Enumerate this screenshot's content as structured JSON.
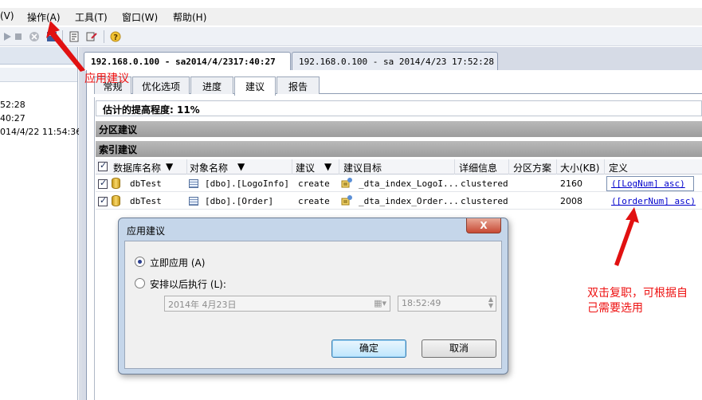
{
  "menu": {
    "items": [
      "(V)",
      "操作(A)",
      "工具(T)",
      "窗口(W)",
      "帮助(H)"
    ]
  },
  "left_panel": {
    "lines": [
      "52:28",
      "40:27",
      "014/4/22 11:54:36"
    ]
  },
  "doc_tabs": [
    "192.168.0.100 - sa2014/4/2317:40:27",
    "192.168.0.100 - sa 2014/4/23 17:52:28"
  ],
  "sub_tabs": [
    "常规",
    "优化选项",
    "进度",
    "建议",
    "报告"
  ],
  "estimate": "估计的提高程度: 11%",
  "sections": {
    "partition": "分区建议",
    "index": "索引建议"
  },
  "grid": {
    "headers": [
      "数据库名称",
      "对象名称",
      "建议",
      "建议目标",
      "详细信息",
      "分区方案",
      "大小(KB)",
      "定义"
    ],
    "rows": [
      {
        "db": "dbTest",
        "object": "[dbo].[LogoInfo]",
        "action": "create",
        "target": "_dta_index_LogoI...",
        "detail": "clustered",
        "partition": "",
        "size": "2160",
        "definition": "([LogNum] asc)"
      },
      {
        "db": "dbTest",
        "object": "[dbo].[Order]",
        "action": "create",
        "target": "_dta_index_Order...",
        "detail": "clustered",
        "partition": "",
        "size": "2008",
        "definition": "([orderNum] asc)"
      }
    ]
  },
  "annotations": {
    "apply_hint": "应用建议",
    "copy_hint_line1": "双击复职，可根据自",
    "copy_hint_line2": "己需要选用",
    "color": "#e11111"
  },
  "dialog": {
    "title": "应用建议",
    "close": "X",
    "option_now": "立即应用 (A)",
    "option_later": "安排以后执行 (L):",
    "date_value": "2014年  4月23日",
    "time_value": "18:52:49",
    "ok": "确定",
    "cancel": "取消"
  }
}
